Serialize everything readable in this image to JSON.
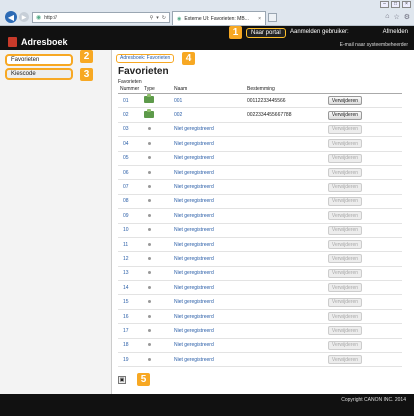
{
  "browser": {
    "address": "http://",
    "tab_title": "Externe UI: Favorieten: MB...",
    "tab_close": "×",
    "window_controls": [
      "–",
      "□",
      "×"
    ]
  },
  "header": {
    "app_title": "Adresboek",
    "portal_button": "Naar portal",
    "login_label": "Aanmelden gebruiker:",
    "logout_link": "Afmelden",
    "email_admin": "E-mail naar systeembeheerder"
  },
  "sidebar": {
    "items": [
      {
        "label": "Favorieten"
      },
      {
        "label": "Kiescode"
      }
    ]
  },
  "main": {
    "breadcrumb": "Adresboek: Favorieten",
    "title": "Favorieten",
    "section": "Favorieten",
    "columns": [
      "Nummer",
      "Type",
      "Naam",
      "Bestemming",
      ""
    ],
    "delete_label": "Verwijderen",
    "rows": [
      {
        "nr": "01",
        "naam": "001",
        "best": "00112233445566",
        "type": "fax",
        "enabled": true
      },
      {
        "nr": "02",
        "naam": "002",
        "best": "0022334455667788",
        "type": "fax",
        "enabled": true
      },
      {
        "nr": "03",
        "naam": "Niet geregistreerd",
        "best": "",
        "type": "none",
        "enabled": false
      },
      {
        "nr": "04",
        "naam": "Niet geregistreerd",
        "best": "",
        "type": "none",
        "enabled": false
      },
      {
        "nr": "05",
        "naam": "Niet geregistreerd",
        "best": "",
        "type": "none",
        "enabled": false
      },
      {
        "nr": "06",
        "naam": "Niet geregistreerd",
        "best": "",
        "type": "none",
        "enabled": false
      },
      {
        "nr": "07",
        "naam": "Niet geregistreerd",
        "best": "",
        "type": "none",
        "enabled": false
      },
      {
        "nr": "08",
        "naam": "Niet geregistreerd",
        "best": "",
        "type": "none",
        "enabled": false
      },
      {
        "nr": "09",
        "naam": "Niet geregistreerd",
        "best": "",
        "type": "none",
        "enabled": false
      },
      {
        "nr": "10",
        "naam": "Niet geregistreerd",
        "best": "",
        "type": "none",
        "enabled": false
      },
      {
        "nr": "11",
        "naam": "Niet geregistreerd",
        "best": "",
        "type": "none",
        "enabled": false
      },
      {
        "nr": "12",
        "naam": "Niet geregistreerd",
        "best": "",
        "type": "none",
        "enabled": false
      },
      {
        "nr": "13",
        "naam": "Niet geregistreerd",
        "best": "",
        "type": "none",
        "enabled": false
      },
      {
        "nr": "14",
        "naam": "Niet geregistreerd",
        "best": "",
        "type": "none",
        "enabled": false
      },
      {
        "nr": "15",
        "naam": "Niet geregistreerd",
        "best": "",
        "type": "none",
        "enabled": false
      },
      {
        "nr": "16",
        "naam": "Niet geregistreerd",
        "best": "",
        "type": "none",
        "enabled": false
      },
      {
        "nr": "17",
        "naam": "Niet geregistreerd",
        "best": "",
        "type": "none",
        "enabled": false
      },
      {
        "nr": "18",
        "naam": "Niet geregistreerd",
        "best": "",
        "type": "none",
        "enabled": false
      },
      {
        "nr": "19",
        "naam": "Niet geregistreerd",
        "best": "",
        "type": "none",
        "enabled": false
      }
    ],
    "top_icon": "▣"
  },
  "callouts": [
    "1",
    "2",
    "3",
    "4",
    "5"
  ],
  "footer": {
    "copyright": "Copyright CANON INC. 2014"
  },
  "colors": {
    "accent": "#f7a823",
    "link": "#2a5ea8",
    "header_bg": "#111111"
  }
}
